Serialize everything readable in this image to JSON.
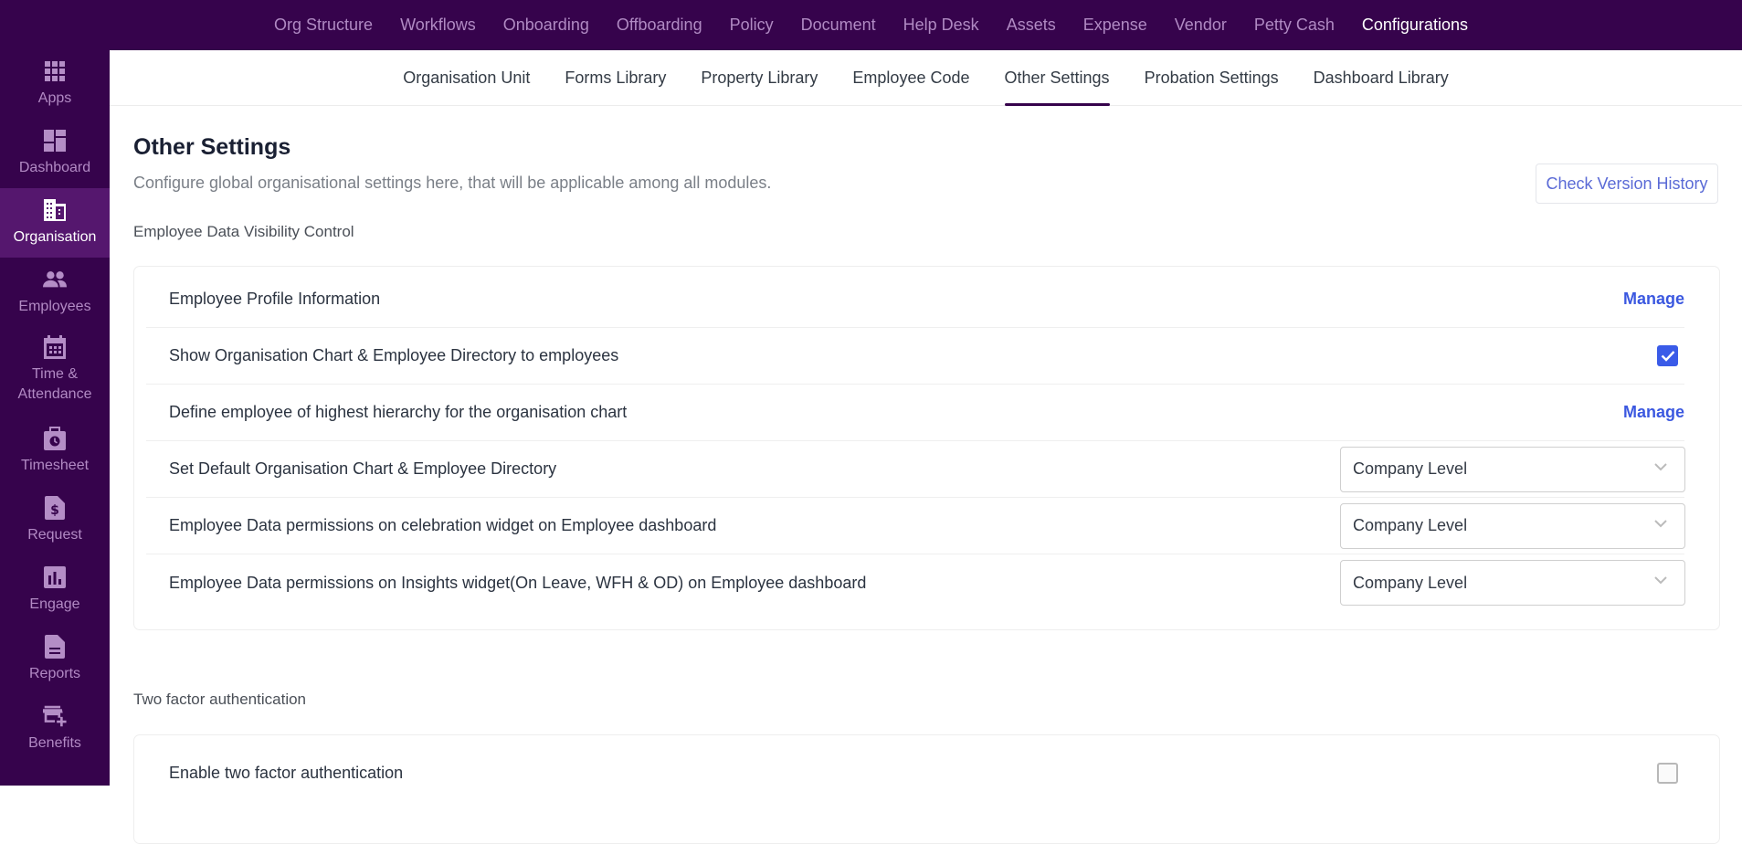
{
  "top_nav": {
    "items": [
      {
        "label": "Org Structure",
        "active": false
      },
      {
        "label": "Workflows",
        "active": false
      },
      {
        "label": "Onboarding",
        "active": false
      },
      {
        "label": "Offboarding",
        "active": false
      },
      {
        "label": "Policy",
        "active": false
      },
      {
        "label": "Document",
        "active": false
      },
      {
        "label": "Help Desk",
        "active": false
      },
      {
        "label": "Assets",
        "active": false
      },
      {
        "label": "Expense",
        "active": false
      },
      {
        "label": "Vendor",
        "active": false
      },
      {
        "label": "Petty Cash",
        "active": false
      },
      {
        "label": "Configurations",
        "active": true
      }
    ]
  },
  "sidebar": {
    "items": [
      {
        "label": "Apps",
        "icon": "apps-grid-icon",
        "active": false
      },
      {
        "label": "Dashboard",
        "icon": "dashboard-icon",
        "active": false
      },
      {
        "label": "Organisation",
        "icon": "building-icon",
        "active": true
      },
      {
        "label": "Employees",
        "icon": "people-icon",
        "active": false
      },
      {
        "label": "Time &\nAttendance",
        "icon": "calendar-icon",
        "active": false
      },
      {
        "label": "Timesheet",
        "icon": "timesheet-icon",
        "active": false
      },
      {
        "label": "Request",
        "icon": "request-dollar-icon",
        "active": false
      },
      {
        "label": "Engage",
        "icon": "bar-chart-icon",
        "active": false
      },
      {
        "label": "Reports",
        "icon": "report-document-icon",
        "active": false
      },
      {
        "label": "Benefits",
        "icon": "store-plus-icon",
        "active": false
      }
    ]
  },
  "sub_tabs": {
    "items": [
      {
        "label": "Organisation Unit",
        "active": false
      },
      {
        "label": "Forms Library",
        "active": false
      },
      {
        "label": "Property Library",
        "active": false
      },
      {
        "label": "Employee Code",
        "active": false
      },
      {
        "label": "Other Settings",
        "active": true
      },
      {
        "label": "Probation Settings",
        "active": false
      },
      {
        "label": "Dashboard Library",
        "active": false
      }
    ]
  },
  "page": {
    "title": "Other Settings",
    "subtitle": "Configure global organisational settings here, that will be applicable among all modules.",
    "version_history_label": "Check Version History"
  },
  "visibility_section": {
    "label": "Employee Data Visibility Control",
    "rows": [
      {
        "text": "Employee Profile Information",
        "control": "link",
        "value": "Manage"
      },
      {
        "text": "Show Organisation Chart & Employee Directory to employees",
        "control": "checkbox",
        "checked": true
      },
      {
        "text": "Define employee of highest hierarchy for the organisation chart",
        "control": "link",
        "value": "Manage"
      },
      {
        "text": "Set Default Organisation Chart & Employee Directory",
        "control": "select",
        "value": "Company Level"
      },
      {
        "text": "Employee Data permissions on celebration widget on Employee dashboard",
        "control": "select",
        "value": "Company Level"
      },
      {
        "text": "Employee Data permissions on Insights widget(On Leave, WFH & OD) on Employee dashboard",
        "control": "select",
        "value": "Company Level"
      }
    ]
  },
  "two_factor_section": {
    "label": "Two factor authentication",
    "rows": [
      {
        "text": "Enable two factor authentication",
        "control": "checkbox",
        "checked": false
      }
    ]
  },
  "colors": {
    "brand_purple": "#36034c",
    "active_sidebar": "#55176e",
    "link_blue": "#3b58e0",
    "checkbox_blue": "#3a5be8"
  }
}
